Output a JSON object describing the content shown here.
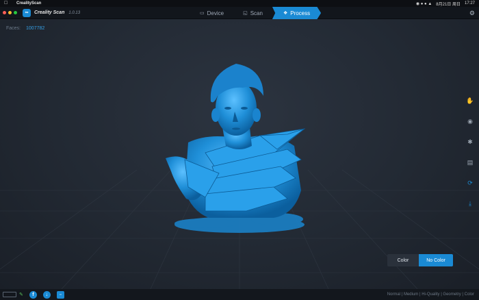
{
  "menubar": {
    "app_name": "CrealityScan",
    "date_time": "8月21日 周日",
    "clock": "17:27"
  },
  "titlebar": {
    "app_title": "Creality Scan",
    "version": "1.0.13",
    "steps": [
      {
        "label": "Device",
        "icon": "device-icon"
      },
      {
        "label": "Scan",
        "icon": "scan-icon"
      },
      {
        "label": "Process",
        "icon": "process-icon"
      }
    ],
    "active_step": "Process"
  },
  "viewport": {
    "faces_label": "Faces:",
    "faces_value": "1007782",
    "model_color": "#1f8fd8",
    "tools": [
      "hand-tool-icon",
      "paint-tool-icon",
      "puzzle-tool-icon",
      "crop-tool-icon",
      "refresh-icon",
      "export-icon"
    ]
  },
  "color_toggle": {
    "options": [
      "Color",
      "No Color"
    ],
    "selected": "No Color"
  },
  "footer": {
    "modes": "Normal | Medium | Hi-Quality | Geometry | Color",
    "accent": "#1a8ad4"
  }
}
